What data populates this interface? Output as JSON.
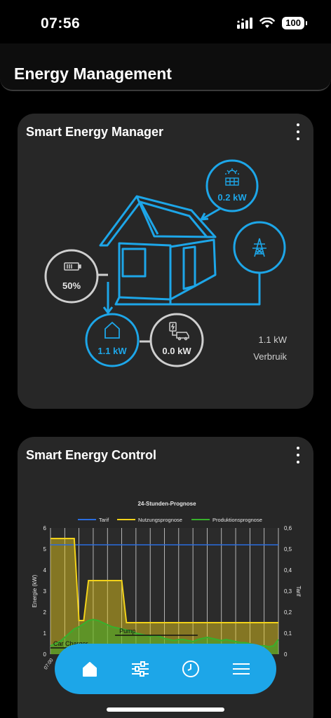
{
  "status_bar": {
    "time": "07:56",
    "battery": "100"
  },
  "header": {
    "title": "Energy Management"
  },
  "smart_energy_manager": {
    "title": "Smart Energy Manager",
    "solar": {
      "value": "0.2 kW",
      "icon": "solar-panel-icon"
    },
    "grid": {
      "icon": "power-pylon-icon"
    },
    "battery": {
      "value": "50%",
      "icon": "battery-icon"
    },
    "house": {
      "value": "1.1 kW",
      "icon": "house-icon"
    },
    "ev_charger": {
      "value": "0.0 kW",
      "icon": "ev-charger-icon"
    },
    "consumption": {
      "value": "1.1 kW",
      "label": "Verbruik"
    },
    "colors": {
      "accent": "#1da6e8",
      "neutral": "#cfcfcf",
      "card": "#272727"
    }
  },
  "smart_energy_control": {
    "title": "Smart Energy Control"
  },
  "chart_data": {
    "type": "line",
    "title": "24-Stunden-Prognose",
    "legend": [
      "Tarif",
      "Nutzungsprognose",
      "Produktionsprognose"
    ],
    "legend_placement": "top",
    "ylabel": "Energie (kW)",
    "y2label": "Tarif",
    "ylim": [
      0,
      6
    ],
    "y2lim": [
      0,
      0.6
    ],
    "yticks": [
      "0",
      "1",
      "2",
      "3",
      "4",
      "5",
      "6"
    ],
    "y2ticks": [
      "0",
      "0,1",
      "0,2",
      "0,3",
      "0,4",
      "0,5",
      "0,6"
    ],
    "x_first_tick": "07:00",
    "x": [
      0,
      0.5,
      1,
      1.5,
      2,
      2.5,
      3,
      3.5,
      4,
      4.5,
      5,
      5.5,
      6,
      6.5,
      7,
      7.5,
      8,
      8.5,
      9,
      9.5,
      10,
      10.5,
      11,
      11.5,
      12,
      12.5,
      13,
      13.5,
      14,
      14.5,
      15,
      15.5,
      16,
      16.5,
      17,
      17.5,
      18,
      18.5,
      19,
      19.5,
      20,
      20.5,
      21,
      21.5,
      22,
      22.5,
      23,
      23.5,
      24
    ],
    "series": [
      {
        "name": "Tarif",
        "color": "#2a6de0",
        "axis": "right",
        "values": [
          0.52,
          0.52,
          0.52,
          0.52,
          0.52,
          0.52,
          0.52,
          0.52,
          0.52,
          0.52,
          0.52,
          0.52,
          0.52,
          0.52,
          0.52,
          0.52,
          0.52,
          0.52,
          0.52,
          0.52,
          0.52,
          0.52,
          0.52,
          0.52,
          0.52,
          0.52,
          0.52,
          0.52,
          0.52,
          0.52,
          0.52,
          0.52,
          0.52,
          0.52,
          0.52,
          0.52,
          0.52,
          0.52,
          0.52,
          0.52,
          0.52,
          0.52,
          0.52,
          0.52,
          0.52,
          0.52,
          0.52,
          0.52,
          0.52
        ]
      },
      {
        "name": "Nutzungsprognose",
        "color": "#f2d21a",
        "axis": "left",
        "values": [
          5.5,
          5.5,
          5.5,
          5.5,
          5.5,
          5.5,
          1.6,
          1.6,
          3.5,
          3.5,
          3.5,
          3.5,
          3.5,
          3.5,
          3.5,
          3.5,
          1.5,
          1.5,
          1.5,
          1.5,
          1.5,
          1.5,
          1.5,
          1.5,
          1.5,
          1.5,
          1.5,
          1.5,
          1.5,
          1.5,
          1.5,
          1.5,
          1.5,
          1.5,
          1.5,
          1.5,
          1.5,
          1.5,
          1.5,
          1.5,
          1.5,
          1.5,
          1.5,
          1.5,
          1.5,
          1.5,
          1.5,
          1.5,
          1.5
        ]
      },
      {
        "name": "Produktionsprognose",
        "color": "#38b02c",
        "axis": "left",
        "values": [
          0.4,
          0.5,
          0.6,
          0.8,
          1.0,
          1.2,
          1.3,
          1.45,
          1.6,
          1.65,
          1.6,
          1.5,
          1.4,
          1.3,
          1.25,
          1.2,
          1.15,
          1.1,
          1.0,
          0.95,
          0.9,
          0.85,
          0.9,
          0.85,
          0.75,
          0.7,
          0.65,
          0.7,
          0.7,
          0.65,
          0.6,
          0.7,
          0.75,
          0.8,
          0.75,
          0.7,
          0.65,
          0.7,
          0.65,
          0.6,
          0.55,
          0.55,
          0.5,
          0.45,
          0.4,
          0.4,
          0.35,
          0.4,
          0.7
        ]
      }
    ],
    "annotations": [
      {
        "label": "Pump",
        "from": 6.8,
        "to": 15.5,
        "y": 0.9
      },
      {
        "label": "Car Charger",
        "from": 0,
        "to": 6,
        "y": 0.3
      }
    ],
    "grid": true
  },
  "nav": {
    "items": [
      {
        "name": "nav-home",
        "icon": "house-icon"
      },
      {
        "name": "nav-controls",
        "icon": "sliders-icon"
      },
      {
        "name": "nav-history",
        "icon": "clock-icon"
      },
      {
        "name": "nav-menu",
        "icon": "menu-icon"
      }
    ]
  }
}
